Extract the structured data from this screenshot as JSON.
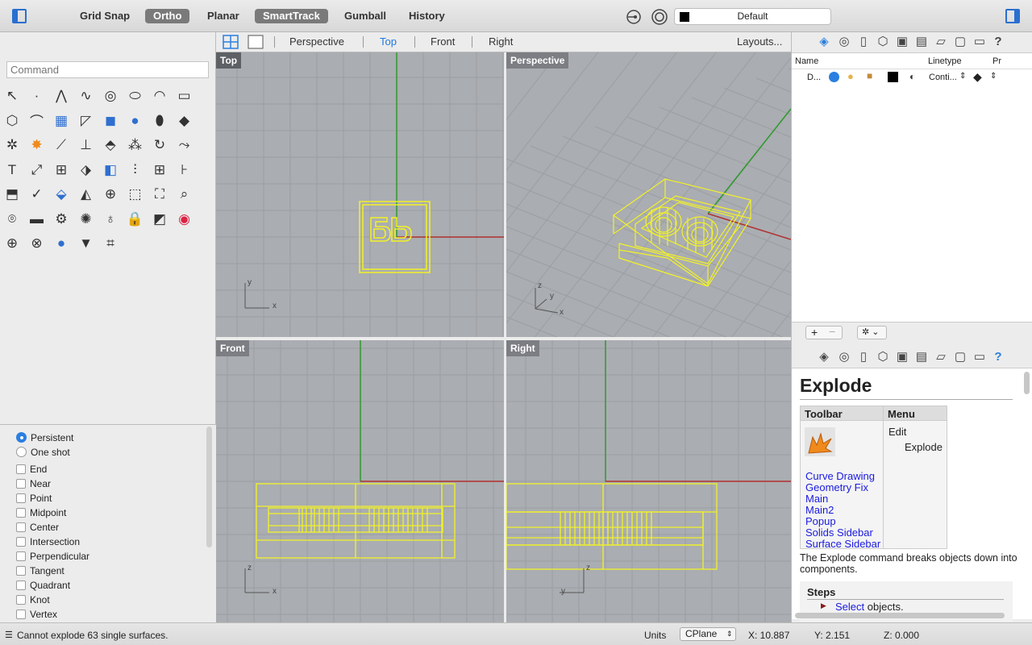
{
  "toolbar": {
    "grid_snap": "Grid Snap",
    "ortho": "Ortho",
    "planar": "Planar",
    "smarttrack": "SmartTrack",
    "gumball": "Gumball",
    "history": "History",
    "layer_default": "Default"
  },
  "left": {
    "command_placeholder": "Command",
    "tools": [
      "select-arrow",
      "point",
      "polyline",
      "curve",
      "circle",
      "ellipse",
      "arc",
      "rectangle",
      "polygon",
      "fillet",
      "surface-grid",
      "loft",
      "box",
      "sphere",
      "cylinder",
      "plane",
      "gear",
      "explode",
      "trim",
      "split",
      "boolean",
      "mesh",
      "rotate",
      "offset",
      "text",
      "scale",
      "array",
      "transform",
      "solid-box",
      "contour",
      "grid",
      "dim",
      "extrude",
      "check",
      "extract",
      "drape",
      "zoom",
      "zoom-window",
      "zoom-extents",
      "zoom-select",
      "render",
      "car",
      "lights",
      "sun",
      "bulb",
      "lock",
      "material",
      "color-wheel",
      "globe",
      "rendered-sphere",
      "ball",
      "cone",
      "spline"
    ],
    "osnap": {
      "persistent": "Persistent",
      "one_shot": "One shot",
      "items": [
        "End",
        "Near",
        "Point",
        "Midpoint",
        "Center",
        "Intersection",
        "Perpendicular",
        "Tangent",
        "Quadrant",
        "Knot",
        "Vertex"
      ]
    }
  },
  "viewtabs": {
    "perspective": "Perspective",
    "top": "Top",
    "front": "Front",
    "right": "Right",
    "layouts": "Layouts..."
  },
  "viewports": {
    "top_label": "Top",
    "perspective_label": "Perspective",
    "front_label": "Front",
    "right_label": "Right",
    "x": "x",
    "y": "y",
    "z": "z"
  },
  "layers": {
    "col_name": "Name",
    "col_linetype": "Linetype",
    "col_print": "Pr",
    "row_name": "D...",
    "row_linetype": "Conti..."
  },
  "help": {
    "title": "Explode",
    "col_toolbar": "Toolbar",
    "col_menu": "Menu",
    "menu_1": "Edit",
    "menu_2": "Explode",
    "links": [
      "Curve Drawing",
      "Geometry Fix",
      "Main",
      "Main2",
      "Popup",
      "Solids Sidebar",
      "Surface Sidebar"
    ],
    "description": "The Explode command breaks objects down into components.",
    "steps_title": "Steps",
    "step_1_link": "Select",
    "step_1_text": " objects."
  },
  "status": {
    "message": "Cannot explode 63 single surfaces.",
    "units": "Units",
    "cplane": "CPlane",
    "x": "X: 10.887",
    "y": "Y: 2.151",
    "z": "Z: 0.000"
  },
  "colors": {
    "accent": "#1f7ae0",
    "geometry": "#f2f227",
    "x_axis": "#b03030",
    "y_axis": "#2f9a2f",
    "viewport_bg": "#aaadb1"
  }
}
